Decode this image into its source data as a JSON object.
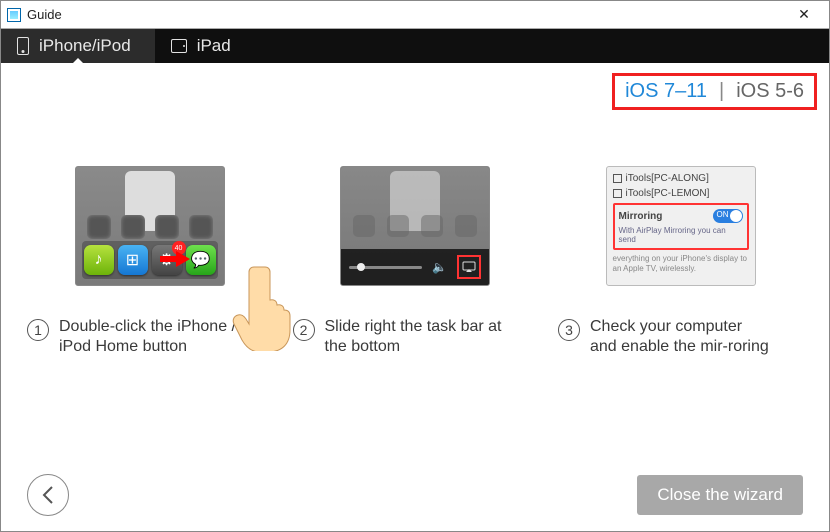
{
  "window": {
    "title": "Guide"
  },
  "tabs": [
    {
      "label": "iPhone/iPod",
      "active": true
    },
    {
      "label": "iPad",
      "active": false
    }
  ],
  "ios_versions": {
    "option_a": "iOS 7–11",
    "separator": "|",
    "option_b": "iOS 5-6"
  },
  "steps": [
    {
      "num": "1",
      "caption": "Double-click the iPhone / iPod Home button"
    },
    {
      "num": "2",
      "caption": "Slide right the task bar at the bottom"
    },
    {
      "num": "3",
      "caption": "Check your computer and enable the mir-roring"
    }
  ],
  "step1_dock": {
    "app_labels": [
      "QQ音乐",
      "iTools",
      "Settings",
      "WeChat"
    ],
    "badge": "40"
  },
  "step3_panel": {
    "device_a": "iTools[PC-ALONG]",
    "device_b": "iTools[PC-LEMON]",
    "mirroring_label": "Mirroring",
    "toggle_state": "ON",
    "hint": "With AirPlay Mirroring you can send",
    "footer": "everything on your iPhone's display to an Apple TV, wirelessly."
  },
  "footer": {
    "close_label": "Close the wizard"
  }
}
